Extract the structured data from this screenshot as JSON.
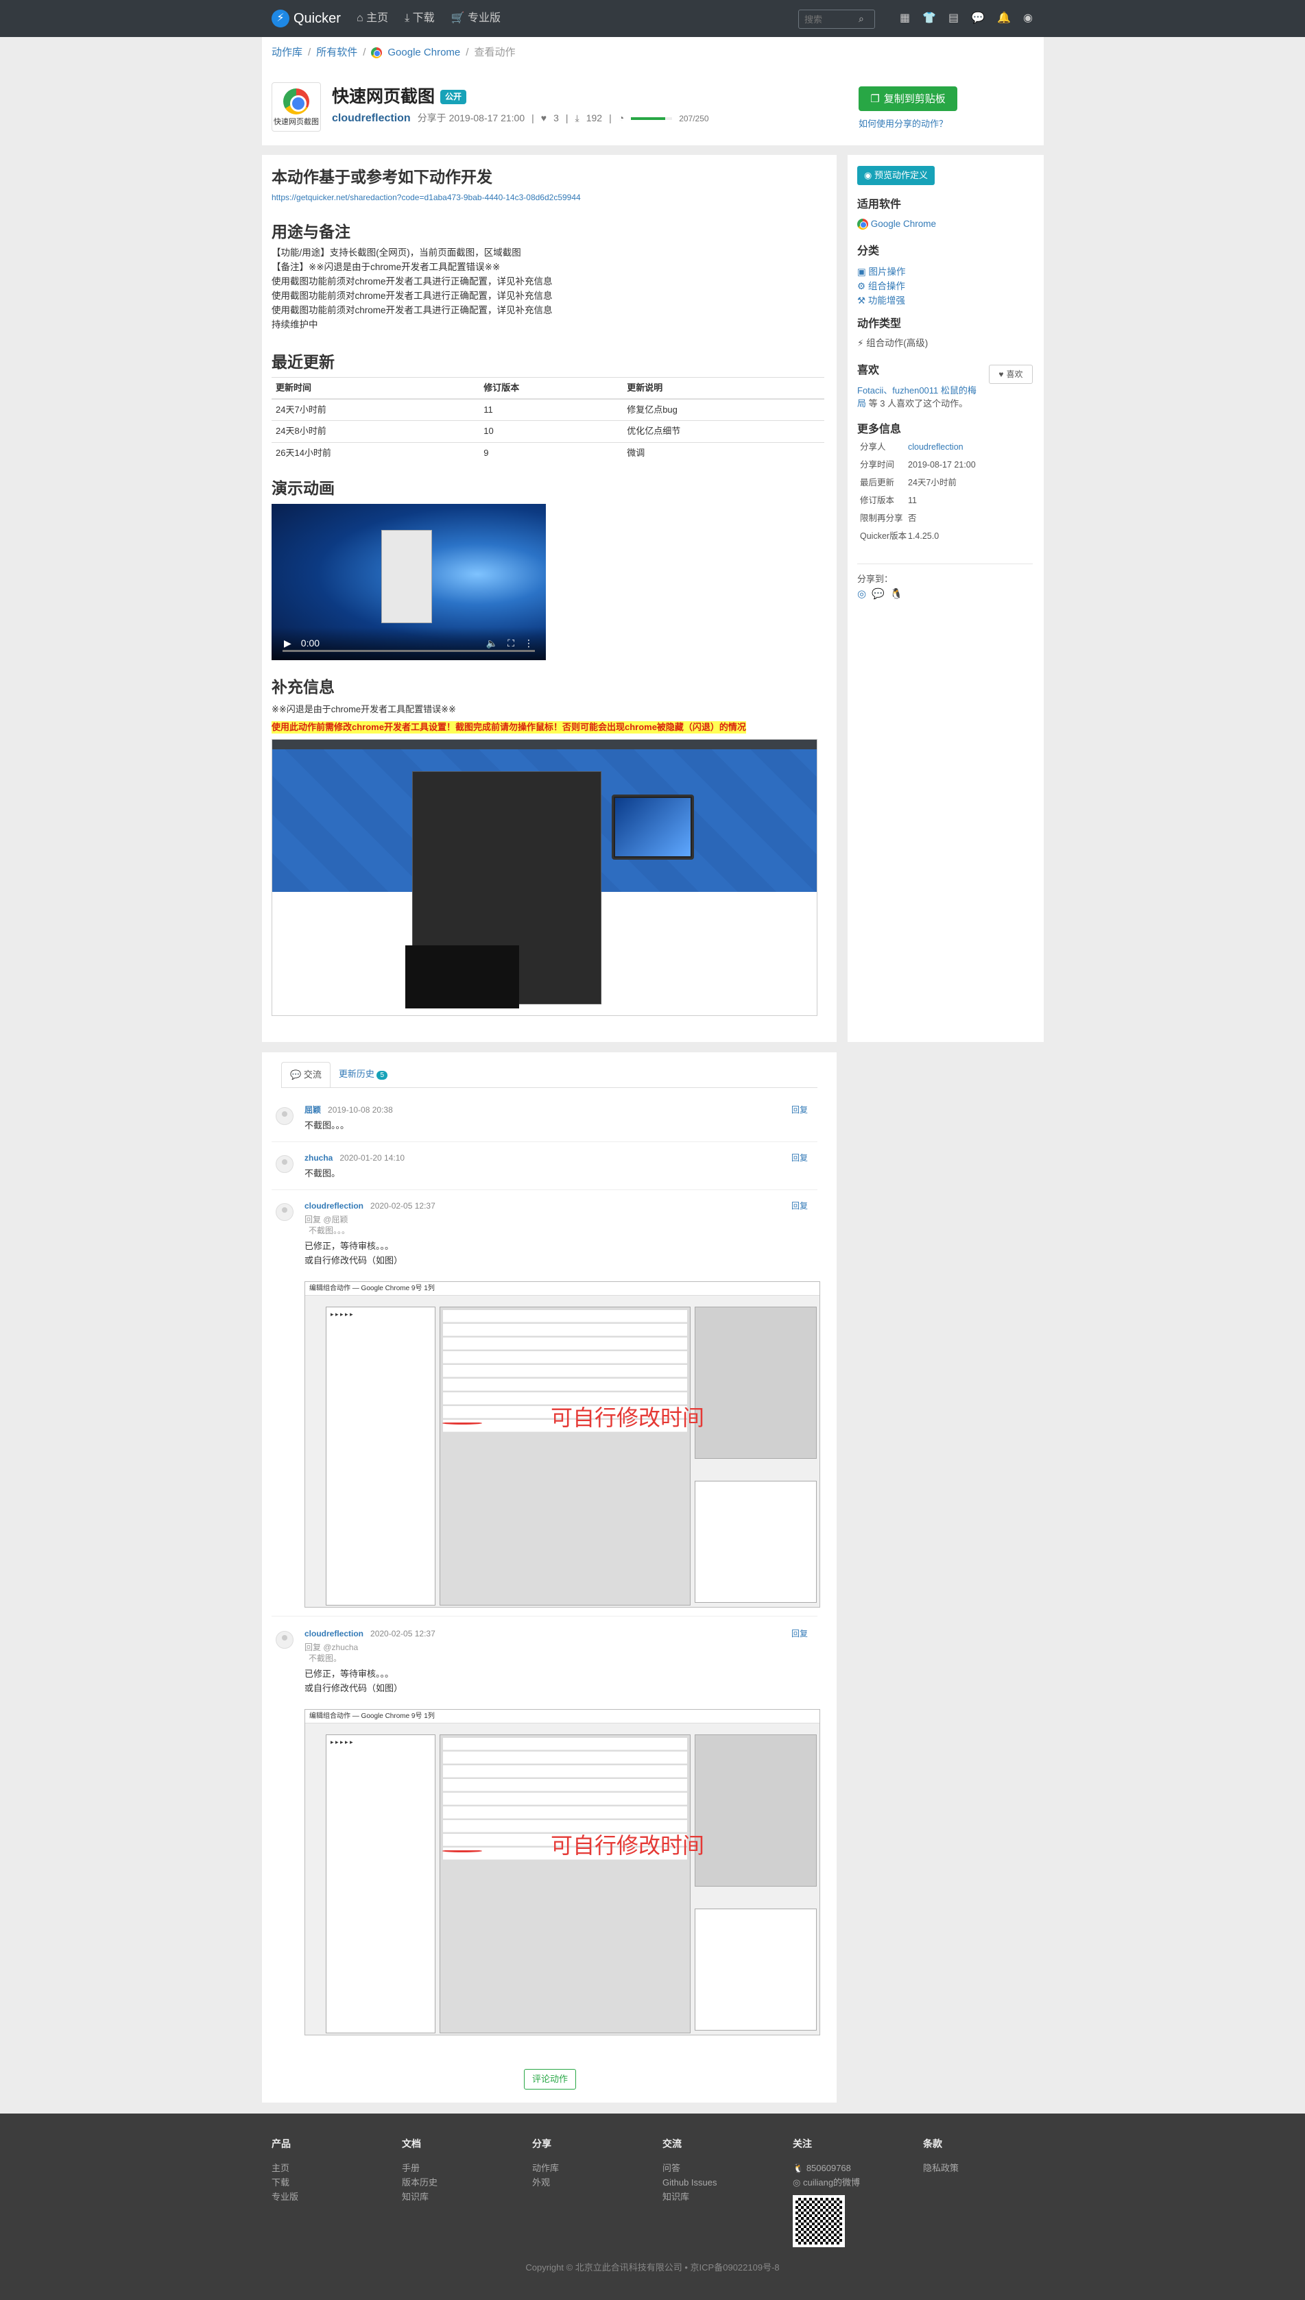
{
  "nav": {
    "brand": "Quicker",
    "links": [
      "主页",
      "下载",
      "专业版"
    ],
    "search_placeholder": "搜索",
    "icons": [
      "grid-icon",
      "shirt-icon",
      "table-icon",
      "chat-icon",
      "bell-icon",
      "user-icon"
    ]
  },
  "breadcrumb": [
    "动作库",
    "所有软件",
    "Google Chrome",
    "查看动作"
  ],
  "action": {
    "icon_label": "快速网页截图",
    "title": "快速网页截图",
    "badge": "公开",
    "author": "cloudreflection",
    "shared": "分享于 2019-08-17 21:00",
    "likes": "3",
    "downloads": "192",
    "progress_text": "207/250",
    "progress": 0.83,
    "copy_button": "复制到剪贴板",
    "howto": "如何使用分享的动作？"
  },
  "main": {
    "based_title": "本动作基于或参考如下动作开发",
    "based_link": "https://getquicker.net/sharedaction?code=d1aba473-9bab-4440-14c3-08d6d2c59944",
    "usage_title": "用途与备注",
    "usage_lines": [
      "【功能/用途】支持长截图(全网页)，当前页面截图，区域截图",
      "【备注】※※闪退是由于chrome开发者工具配置错误※※",
      "使用截图功能前须对chrome开发者工具进行正确配置，详见补充信息",
      "使用截图功能前须对chrome开发者工具进行正确配置，详见补充信息",
      "使用截图功能前须对chrome开发者工具进行正确配置，详见补充信息",
      "持续维护中"
    ],
    "recent_title": "最近更新",
    "table_headers": [
      "更新时间",
      "修订版本",
      "更新说明"
    ],
    "table_rows": [
      [
        "24天7小时前",
        "11",
        "修复亿点bug"
      ],
      [
        "24天8小时前",
        "10",
        "优化亿点细节"
      ],
      [
        "26天14小时前",
        "9",
        "微调"
      ]
    ],
    "demo_title": "演示动画",
    "video_time": "0:00",
    "extra_title": "补充信息",
    "extra_note": "※※闪退是由于chrome开发者工具配置错误※※",
    "extra_warning": "使用此动作前需修改chrome开发者工具设置！截图完成前请勿操作鼠标！否则可能会出现chrome被隐藏（闪退）的情况"
  },
  "side": {
    "preview_button": "预览动作定义",
    "software_title": "适用软件",
    "software": "Google Chrome",
    "category_title": "分类",
    "categories": [
      "图片操作",
      "组合操作",
      "功能增强"
    ],
    "type_title": "动作类型",
    "type": "组合动作(高级)",
    "like_title": "喜欢",
    "like_button": "喜欢",
    "like_users": "Fotacii、fuzhen0011 松鼠的梅局",
    "like_count_text": "等 3 人喜欢了这个动作。",
    "more_title": "更多信息",
    "info": [
      [
        "分享人",
        "cloudreflection"
      ],
      [
        "分享时间",
        "2019-08-17 21:00"
      ],
      [
        "最后更新",
        "24天7小时前"
      ],
      [
        "修订版本",
        "11"
      ],
      [
        "限制再分享",
        "否"
      ],
      [
        "Quicker版本",
        "1.4.25.0"
      ]
    ],
    "share_title": "分享到："
  },
  "comments": {
    "tab_discuss": "交流",
    "tab_history": "更新历史",
    "history_count": "5",
    "reply_label": "回复",
    "items": [
      {
        "name": "屈颖",
        "time": "2019-10-08 20:38",
        "text": "不截图。。。"
      },
      {
        "name": "zhucha",
        "time": "2020-01-20 14:10",
        "text": "不截图。"
      },
      {
        "name": "cloudreflection",
        "time": "2020-02-05 12:37",
        "quote_to": "回复 @屈颖",
        "quote": "不截图。。。",
        "line1": "已修正，等待审核。。。",
        "line2": "或自行修改代码（如图）"
      },
      {
        "name": "cloudreflection",
        "time": "2020-02-05 12:37",
        "quote_to": "回复 @zhucha",
        "quote": "不截图。",
        "line1": "已修正，等待审核。。。",
        "line2": "或自行修改代码（如图）"
      }
    ],
    "window_title": "编辑组合动作 — Google Chrome 9号 1列",
    "window_note": "可自行修改时间",
    "discuss_button": "评论动作"
  },
  "footer": {
    "cols": [
      {
        "title": "产品",
        "items": [
          "主页",
          "下载",
          "专业版"
        ]
      },
      {
        "title": "文档",
        "items": [
          "手册",
          "版本历史",
          "知识库"
        ]
      },
      {
        "title": "分享",
        "items": [
          "动作库",
          "外观"
        ]
      },
      {
        "title": "交流",
        "items": [
          "问答",
          "Github Issues",
          "知识库"
        ]
      },
      {
        "title": "关注",
        "items": [
          "850609768",
          "cuiliang的微博"
        ]
      },
      {
        "title": "条款",
        "items": [
          "隐私政策"
        ]
      }
    ],
    "copyright": "Copyright © 北京立此合讯科技有限公司 • 京ICP备09022109号-8"
  }
}
